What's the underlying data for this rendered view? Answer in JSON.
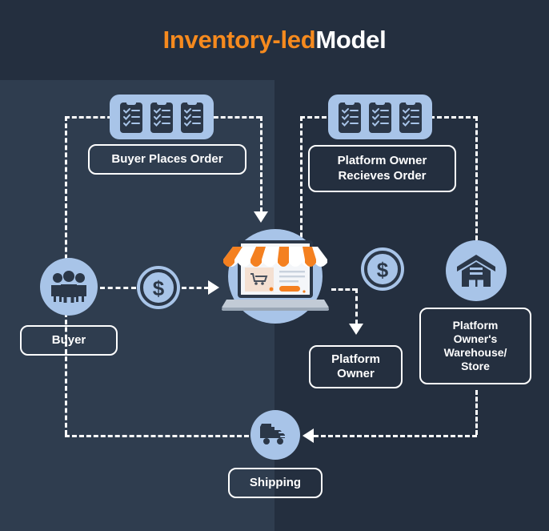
{
  "header": {
    "title_accent": "Inventory-led",
    "title_plain": "Model"
  },
  "colors": {
    "background_dark": "#242f3f",
    "panel_light": "#2f3d4f",
    "accent_orange": "#f68a1e",
    "icon_blue": "#a8c4e8",
    "icon_dark": "#2b3748",
    "line_white": "#ffffff"
  },
  "nodes": {
    "buyer_places_order": {
      "label": "Buyer Places Order",
      "icon": "clipboards-icon"
    },
    "platform_owner_receives_order": {
      "label": "Platform Owner\nRecieves Order",
      "icon": "clipboards-icon"
    },
    "buyer": {
      "label": "Buyer",
      "icon": "group-of-people-icon"
    },
    "platform_owner": {
      "label": "Platform\nOwner",
      "icon": ""
    },
    "platform_owner_warehouse": {
      "label": "Platform\nOwner's\nWarehouse/\nStore",
      "icon": "warehouse-icon"
    },
    "shipping": {
      "label": "Shipping",
      "icon": "delivery-truck-icon"
    },
    "marketplace": {
      "icon": "online-storefront-icon"
    },
    "payment_left": {
      "icon": "dollar-coin-icon"
    },
    "payment_right": {
      "icon": "dollar-coin-icon"
    }
  },
  "connectors": {
    "buyer_to_shop": "dashed-arrow-right",
    "order_path_left": "dashed-arrow-down",
    "shop_to_platform_owner": "dashed-arrow-down",
    "warehouse_to_shipping": "dashed-arrow-left",
    "shipping_to_buyer": "dashed-line"
  }
}
